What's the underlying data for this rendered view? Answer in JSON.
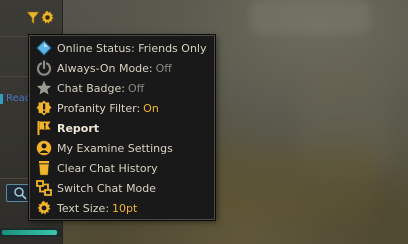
{
  "menu": {
    "items": [
      {
        "id": "online-status",
        "label": "Online Status: Friends Only",
        "value": "",
        "value_style": "",
        "icon": "diamond-icon"
      },
      {
        "id": "always-on-mode",
        "label": "Always-On Mode:",
        "value": "Off",
        "value_style": "grey",
        "icon": "power-icon"
      },
      {
        "id": "chat-badge",
        "label": "Chat Badge:",
        "value": "Off",
        "value_style": "grey",
        "icon": "star-icon"
      },
      {
        "id": "profanity-filter",
        "label": "Profanity Filter:",
        "value": "On",
        "value_style": "gold",
        "icon": "warning-icon"
      },
      {
        "id": "report",
        "label": "Report",
        "value": "",
        "value_style": "",
        "icon": "report-flag-icon"
      },
      {
        "id": "my-examine-settings",
        "label": "My Examine Settings",
        "value": "",
        "value_style": "",
        "icon": "user-icon"
      },
      {
        "id": "clear-chat-history",
        "label": "Clear Chat History",
        "value": "",
        "value_style": "",
        "icon": "trash-icon"
      },
      {
        "id": "switch-chat-mode",
        "label": "Switch Chat Mode",
        "value": "",
        "value_style": "",
        "icon": "switch-icon"
      },
      {
        "id": "text-size",
        "label": "Text Size:",
        "value": "10pt",
        "value_style": "gold",
        "icon": "gear-icon"
      }
    ]
  },
  "left_panel": {
    "fragment_text": "Read"
  },
  "colors": {
    "gold": "#f2b42a",
    "grey_value": "#8c8a82",
    "menu_bg": "#191919",
    "text": "#d8d2c2"
  }
}
